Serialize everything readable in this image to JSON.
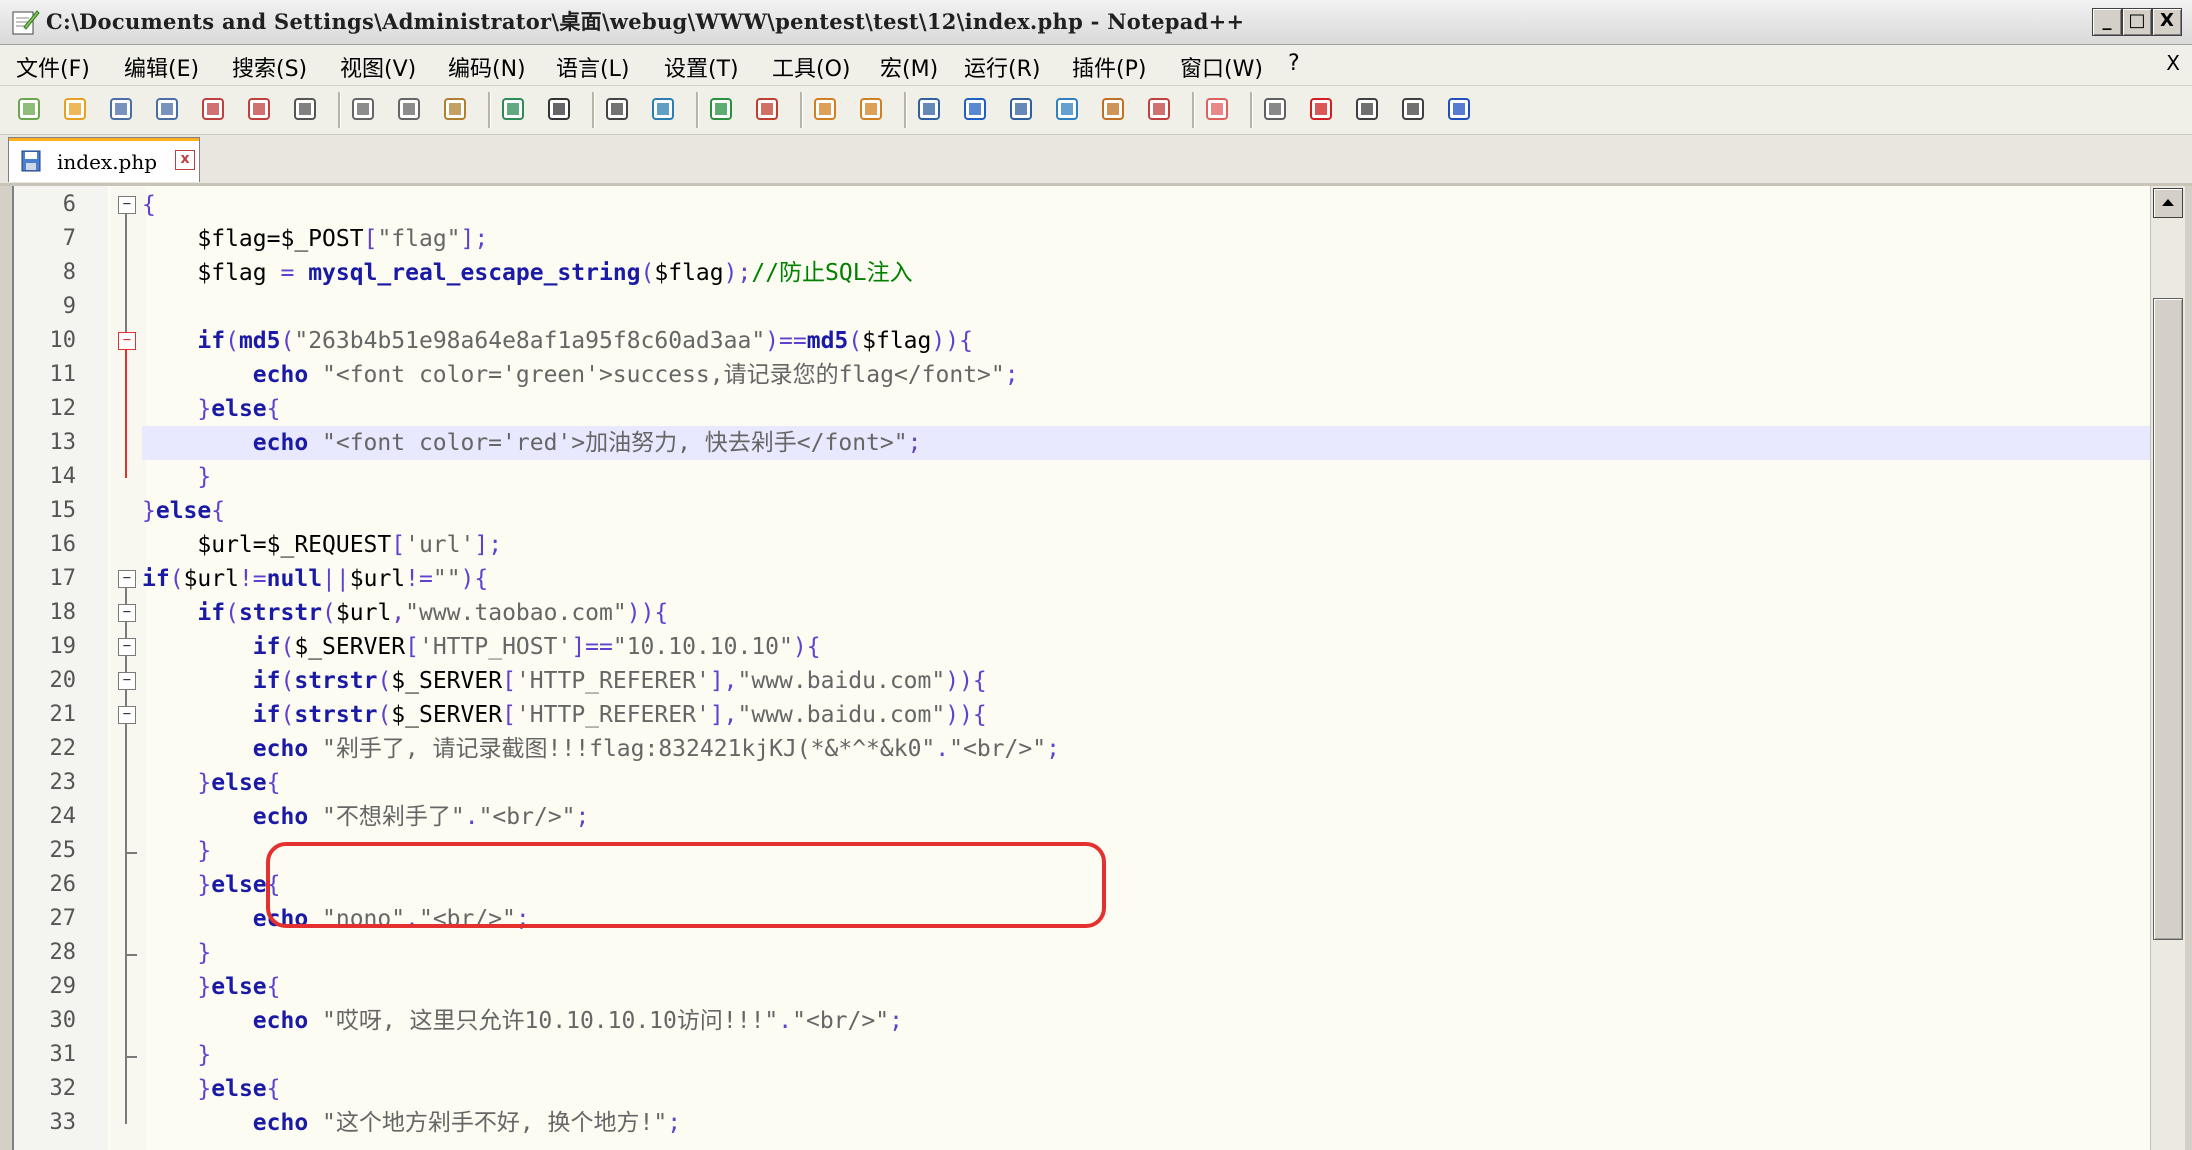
{
  "window": {
    "title": "C:\\Documents and Settings\\Administrator\\桌面\\webug\\WWW\\pentest\\test\\12\\index.php - Notepad++",
    "min_label": "_",
    "max_label": "□",
    "close_label": "X"
  },
  "menu": {
    "items": [
      "文件(F)",
      "编辑(E)",
      "搜索(S)",
      "视图(V)",
      "编码(N)",
      "语言(L)",
      "设置(T)",
      "工具(O)",
      "宏(M)",
      "运行(R)",
      "插件(P)",
      "窗口(W)",
      "?"
    ],
    "close": "X"
  },
  "toolbar": {
    "icons": [
      "new-file-icon",
      "open-file-icon",
      "save-icon",
      "save-all-icon",
      "close-icon",
      "close-all-icon",
      "print-icon",
      "cut-icon",
      "copy-icon",
      "paste-icon",
      "undo-icon",
      "redo-icon",
      "find-icon",
      "replace-icon",
      "zoom-in-icon",
      "zoom-out-icon",
      "sync-vertical-icon",
      "sync-horizontal-icon",
      "word-wrap-icon",
      "show-all-chars-icon",
      "indent-guide-icon",
      "doc-map-icon",
      "function-list-icon",
      "folder-workspace-icon",
      "monitoring-icon",
      "record-macro-icon",
      "stop-record-icon",
      "play-macro-icon",
      "run-macro-multiple-icon",
      "save-macro-icon"
    ]
  },
  "tab": {
    "label": "index.php",
    "close": "x"
  },
  "editor": {
    "lines": [
      {
        "n": "6",
        "fold": "open",
        "segs": [
          [
            "op",
            "{"
          ]
        ]
      },
      {
        "n": "7",
        "fold": "",
        "segs": [
          [
            "var",
            "    $flag="
          ],
          [
            "var",
            "$_POST"
          ],
          [
            "op",
            "["
          ],
          [
            "str",
            "\"flag\""
          ],
          [
            "op",
            "];"
          ]
        ]
      },
      {
        "n": "8",
        "fold": "",
        "segs": [
          [
            "var",
            "    $flag "
          ],
          [
            "op",
            "= "
          ],
          [
            "fn",
            "mysql_real_escape_string"
          ],
          [
            "op",
            "("
          ],
          [
            "var",
            "$flag"
          ],
          [
            "op",
            ");"
          ],
          [
            "cm",
            "//防止SQL注入"
          ]
        ]
      },
      {
        "n": "9",
        "fold": "",
        "segs": []
      },
      {
        "n": "10",
        "fold": "red",
        "segs": [
          [
            "kw",
            "    if"
          ],
          [
            "op",
            "("
          ],
          [
            "fn",
            "md5"
          ],
          [
            "op",
            "("
          ],
          [
            "str",
            "\"263b4b51e98a64e8af1a95f8c60ad3aa\""
          ],
          [
            "op",
            ")=="
          ],
          [
            "fn",
            "md5"
          ],
          [
            "op",
            "("
          ],
          [
            "var",
            "$flag"
          ],
          [
            "op",
            ")){"
          ]
        ]
      },
      {
        "n": "11",
        "fold": "",
        "segs": [
          [
            "kw",
            "        echo "
          ],
          [
            "str",
            "\"<font color='green'>success,请记录您的flag</font>\""
          ],
          [
            "op",
            ";"
          ]
        ]
      },
      {
        "n": "12",
        "fold": "",
        "segs": [
          [
            "op",
            "    }"
          ],
          [
            "kw",
            "else"
          ],
          [
            "op",
            "{"
          ]
        ]
      },
      {
        "n": "13",
        "fold": "",
        "hl": true,
        "segs": [
          [
            "kw",
            "        echo "
          ],
          [
            "str",
            "\"<font color='red'>加油努力, 快去剁手</font>\""
          ],
          [
            "op",
            ";"
          ]
        ]
      },
      {
        "n": "14",
        "fold": "",
        "segs": [
          [
            "op",
            "    }"
          ]
        ]
      },
      {
        "n": "15",
        "fold": "",
        "segs": [
          [
            "op",
            "}"
          ],
          [
            "kw",
            "else"
          ],
          [
            "op",
            "{"
          ]
        ]
      },
      {
        "n": "16",
        "fold": "",
        "segs": [
          [
            "var",
            "    $url="
          ],
          [
            "var",
            "$_REQUEST"
          ],
          [
            "op",
            "["
          ],
          [
            "str",
            "'url'"
          ],
          [
            "op",
            "];"
          ]
        ]
      },
      {
        "n": "17",
        "fold": "open",
        "segs": [
          [
            "kw",
            "if"
          ],
          [
            "op",
            "("
          ],
          [
            "var",
            "$url"
          ],
          [
            "op",
            "!="
          ],
          [
            "kw",
            "null"
          ],
          [
            "op",
            "||"
          ],
          [
            "var",
            "$url"
          ],
          [
            "op",
            "!="
          ],
          [
            "str",
            "\"\""
          ],
          [
            "op",
            "){"
          ]
        ]
      },
      {
        "n": "18",
        "fold": "open",
        "segs": [
          [
            "kw",
            "    if"
          ],
          [
            "op",
            "("
          ],
          [
            "fn",
            "strstr"
          ],
          [
            "op",
            "("
          ],
          [
            "var",
            "$url"
          ],
          [
            "op",
            ","
          ],
          [
            "str",
            "\"www.taobao.com\""
          ],
          [
            "op",
            ")){"
          ]
        ]
      },
      {
        "n": "19",
        "fold": "open",
        "segs": [
          [
            "kw",
            "        if"
          ],
          [
            "op",
            "("
          ],
          [
            "var",
            "$_SERVER"
          ],
          [
            "op",
            "["
          ],
          [
            "str",
            "'HTTP_HOST'"
          ],
          [
            "op",
            "]=="
          ],
          [
            "str",
            "\"10.10.10.10\""
          ],
          [
            "op",
            "){"
          ]
        ]
      },
      {
        "n": "20",
        "fold": "open",
        "segs": [
          [
            "kw",
            "        if"
          ],
          [
            "op",
            "("
          ],
          [
            "fn",
            "strstr"
          ],
          [
            "op",
            "("
          ],
          [
            "var",
            "$_SERVER"
          ],
          [
            "op",
            "["
          ],
          [
            "str",
            "'HTTP_REFERER'"
          ],
          [
            "op",
            "],"
          ],
          [
            "str",
            "\"www.baidu.com\""
          ],
          [
            "op",
            ")){"
          ]
        ]
      },
      {
        "n": "21",
        "fold": "open",
        "segs": [
          [
            "kw",
            "        if"
          ],
          [
            "op",
            "("
          ],
          [
            "fn",
            "strstr"
          ],
          [
            "op",
            "("
          ],
          [
            "var",
            "$_SERVER"
          ],
          [
            "op",
            "["
          ],
          [
            "str",
            "'HTTP_REFERER'"
          ],
          [
            "op",
            "],"
          ],
          [
            "str",
            "\"www.baidu.com\""
          ],
          [
            "op",
            ")){"
          ]
        ]
      },
      {
        "n": "22",
        "fold": "",
        "segs": [
          [
            "kw",
            "        echo "
          ],
          [
            "str",
            "\"剁手了, 请记录截图!!!flag:832421kjKJ(*&*^*&k0\""
          ],
          [
            "op",
            "."
          ],
          [
            "str",
            "\"<br/>\""
          ],
          [
            "op",
            ";"
          ]
        ]
      },
      {
        "n": "23",
        "fold": "",
        "segs": [
          [
            "op",
            "    }"
          ],
          [
            "kw",
            "else"
          ],
          [
            "op",
            "{"
          ]
        ]
      },
      {
        "n": "24",
        "fold": "",
        "segs": [
          [
            "kw",
            "        echo "
          ],
          [
            "str",
            "\"不想剁手了\""
          ],
          [
            "op",
            "."
          ],
          [
            "str",
            "\"<br/>\""
          ],
          [
            "op",
            ";"
          ]
        ]
      },
      {
        "n": "25",
        "fold": "end",
        "segs": [
          [
            "op",
            "    }"
          ]
        ]
      },
      {
        "n": "26",
        "fold": "",
        "segs": [
          [
            "op",
            "    }"
          ],
          [
            "kw",
            "else"
          ],
          [
            "op",
            "{"
          ]
        ]
      },
      {
        "n": "27",
        "fold": "",
        "segs": [
          [
            "kw",
            "        echo "
          ],
          [
            "str",
            "\"nono\""
          ],
          [
            "op",
            "."
          ],
          [
            "str",
            "\"<br/>\""
          ],
          [
            "op",
            ";"
          ]
        ]
      },
      {
        "n": "28",
        "fold": "end",
        "segs": [
          [
            "op",
            "    }"
          ]
        ]
      },
      {
        "n": "29",
        "fold": "",
        "segs": [
          [
            "op",
            "    }"
          ],
          [
            "kw",
            "else"
          ],
          [
            "op",
            "{"
          ]
        ]
      },
      {
        "n": "30",
        "fold": "",
        "segs": [
          [
            "kw",
            "        echo "
          ],
          [
            "str",
            "\"哎呀, 这里只允许10.10.10.10访问!!!\""
          ],
          [
            "op",
            "."
          ],
          [
            "str",
            "\"<br/>\""
          ],
          [
            "op",
            ";"
          ]
        ]
      },
      {
        "n": "31",
        "fold": "end",
        "segs": [
          [
            "op",
            "    }"
          ]
        ]
      },
      {
        "n": "32",
        "fold": "",
        "segs": [
          [
            "op",
            "    }"
          ],
          [
            "kw",
            "else"
          ],
          [
            "op",
            "{"
          ]
        ]
      },
      {
        "n": "33",
        "fold": "",
        "segs": [
          [
            "kw",
            "        echo "
          ],
          [
            "str",
            "\"这个地方剁手不好, 换个地方!\""
          ],
          [
            "op",
            ";"
          ]
        ]
      }
    ]
  }
}
